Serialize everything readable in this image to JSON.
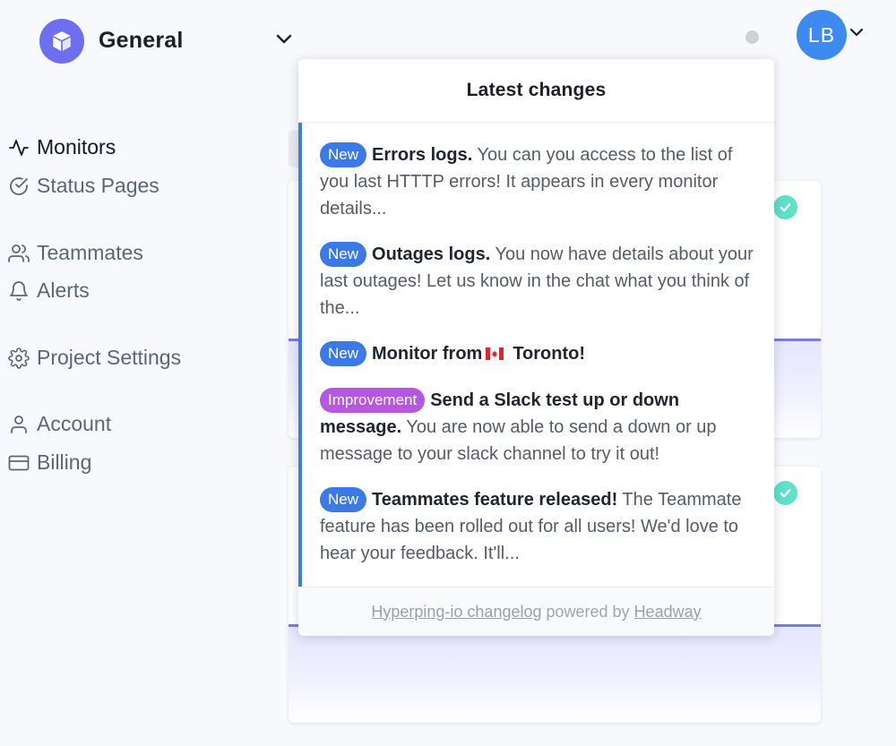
{
  "header": {
    "project_name": "General",
    "avatar_initials": "LB",
    "logo_icon": "cube-icon",
    "accent_color": "#6e6ef0",
    "avatar_color": "#3d8bf0"
  },
  "sidebar": {
    "items": [
      {
        "label": "Monitors",
        "icon": "activity-icon"
      },
      {
        "label": "Status Pages",
        "icon": "check-circle-icon"
      },
      {
        "label": "Teammates",
        "icon": "users-icon"
      },
      {
        "label": "Alerts",
        "icon": "bell-icon"
      },
      {
        "label": "Project Settings",
        "icon": "gear-icon"
      },
      {
        "label": "Account",
        "icon": "user-icon"
      },
      {
        "label": "Billing",
        "icon": "credit-card-icon"
      }
    ]
  },
  "changelog": {
    "title": "Latest changes",
    "entries": [
      {
        "tag": "New",
        "title": "Errors logs.",
        "body": " You can you access to the list of you last HTTTP errors! It appears in every monitor details..."
      },
      {
        "tag": "New",
        "title": "Outages logs.",
        "body": " You now have details about your last outages! Let us know in the chat what you think of the..."
      },
      {
        "tag": "New",
        "title_before_flag": "Monitor from",
        "title_after_flag": "Toronto!",
        "flag_icon": "canada-flag-icon"
      },
      {
        "tag": "Improvement",
        "title": "Send a Slack test up or down message.",
        "body": " You are now able to send a down or up message to your slack channel to try it out!"
      },
      {
        "tag": "New",
        "title": "Teammates feature released!",
        "body": " The Teammate feature has been rolled out for all users! We'd love to hear your feedback. It'll..."
      }
    ],
    "tag_colors": {
      "New": "#3a79e6",
      "Improvement": "#b658dd"
    },
    "footer": {
      "changelog_link": "Hyperping-io changelog",
      "powered_by": "powered by",
      "headway_link": "Headway"
    }
  }
}
